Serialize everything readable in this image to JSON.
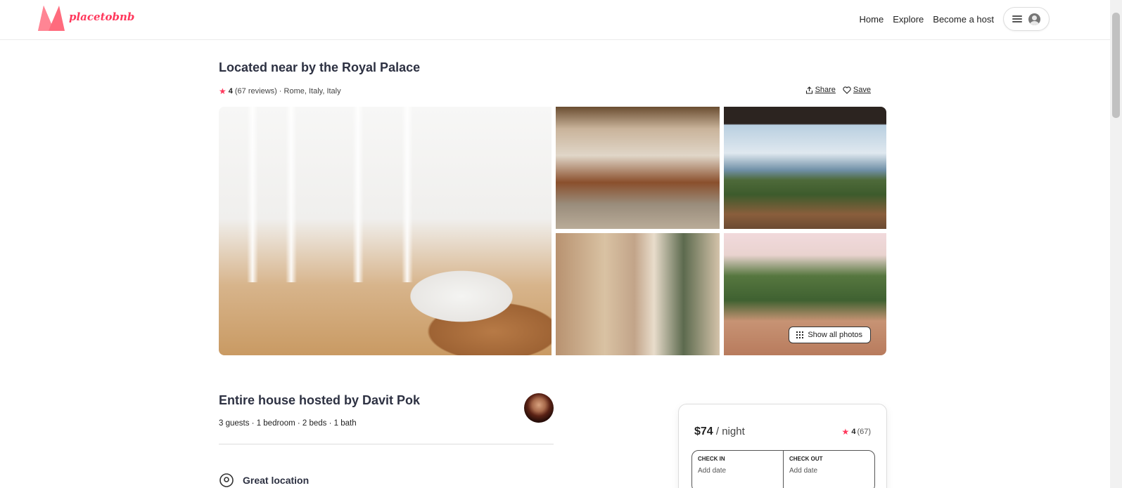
{
  "header": {
    "brand": "placetobnb",
    "nav": [
      "Home",
      "Explore",
      "Become a host"
    ]
  },
  "listing": {
    "title": "Located near by the Royal Palace",
    "rating": "4",
    "reviews": "(67 reviews)",
    "location": "· Rome, Italy, Italy",
    "share_label": "Share",
    "save_label": "Save",
    "show_all_photos": "Show all photos"
  },
  "host": {
    "title": "Entire house hosted by Davit Pok",
    "details": "3 guests · 1 bedroom · 2 beds · 1 bath",
    "feature": "Great location"
  },
  "booking": {
    "price": "$74",
    "per": " / night",
    "rating": "4",
    "count": "(67)",
    "check_in_label": "CHECK IN",
    "check_in_value": "Add date",
    "check_out_label": "CHECK OUT",
    "check_out_value": "Add date"
  },
  "colors": {
    "brand": "#ff385c",
    "heading": "#2d3142"
  },
  "icons": {
    "logo": "logo-icon",
    "menu": "hamburger-icon",
    "user": "user-icon",
    "star": "star-icon",
    "share": "share-icon",
    "save": "heart-icon",
    "grid": "grid-dots-icon",
    "location": "location-pin-icon"
  }
}
